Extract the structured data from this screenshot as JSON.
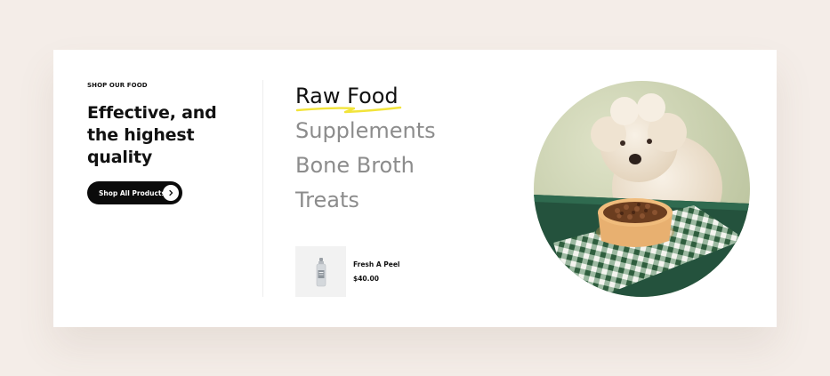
{
  "section": {
    "eyebrow": "SHOP OUR FOOD",
    "headline_lines": [
      "Effective, and",
      "the highest",
      "quality"
    ],
    "cta_label": "Shop All Products",
    "cta_icon": "chevron-right-icon"
  },
  "categories": [
    {
      "label": "Raw Food",
      "active": true
    },
    {
      "label": "Supplements",
      "active": false
    },
    {
      "label": "Bone Broth",
      "active": false
    },
    {
      "label": "Treats",
      "active": false
    }
  ],
  "featured_product": {
    "name": "Fresh A Peel",
    "price": "$40.00"
  },
  "colors": {
    "page_background": "#f4ede8",
    "card_background": "#ffffff",
    "button": "#0b0b0b",
    "highlight_underline": "#f2e43a",
    "inactive_category": "#8c8c8c"
  },
  "image": {
    "subject": "dog-with-food-bowl-photo"
  }
}
